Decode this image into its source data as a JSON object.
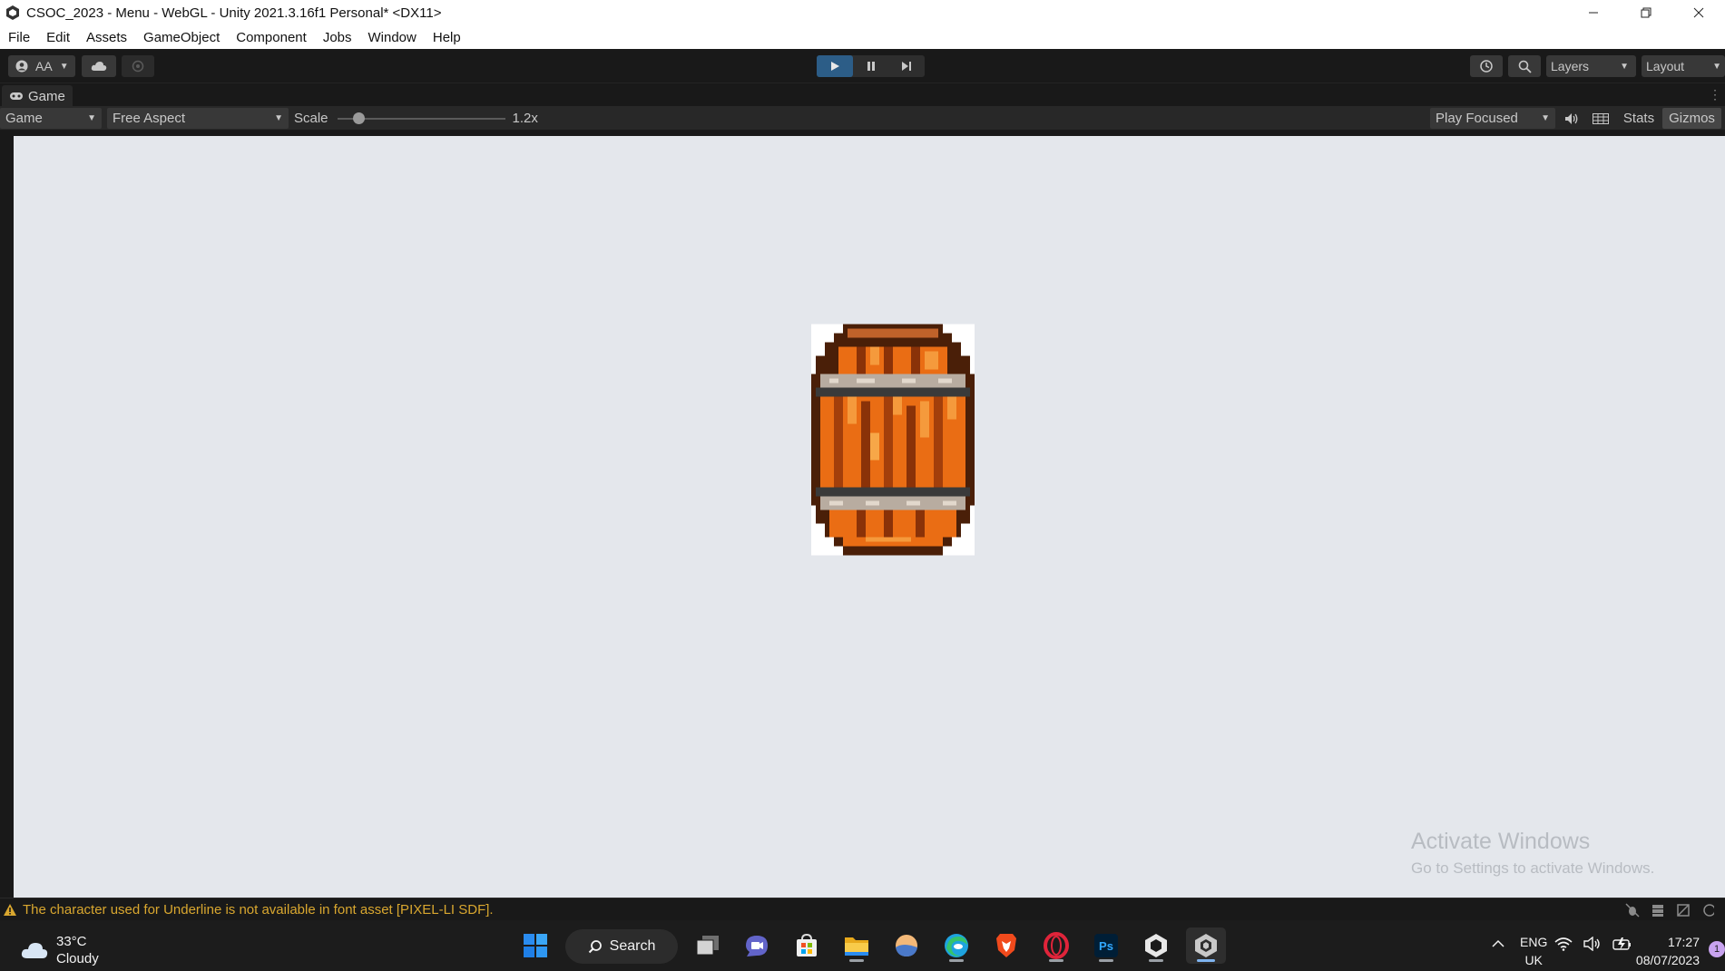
{
  "window": {
    "title": "CSOC_2023 - Menu - WebGL - Unity 2021.3.16f1 Personal* <DX11>",
    "minimize_icon": "minimize-icon",
    "restore_icon": "restore-icon",
    "close_icon": "close-icon"
  },
  "menu": {
    "items": [
      "File",
      "Edit",
      "Assets",
      "GameObject",
      "Component",
      "Jobs",
      "Window",
      "Help"
    ]
  },
  "toolbar": {
    "account_label": "AA",
    "layers_label": "Layers",
    "layout_label": "Layout",
    "play_active_color": "#2c5d87"
  },
  "game_tab": {
    "label": "Game"
  },
  "game_toolbar": {
    "display_label": "Game",
    "aspect_label": "Free Aspect",
    "scale_label": "Scale",
    "scale_value": "1.2x",
    "scale_slider_level": 0.1,
    "play_mode_label": "Play Focused",
    "stats_label": "Stats",
    "gizmos_label": "Gizmos"
  },
  "viewport": {
    "background_color": "#e4e7ec",
    "sprite": "wooden-barrel"
  },
  "watermark": {
    "title": "Activate Windows",
    "subtitle": "Go to Settings to activate Windows."
  },
  "status": {
    "message": "The character used for Underline is not available in font asset [PIXEL-LI SDF].",
    "warning_color": "#d9a72f"
  },
  "taskbar": {
    "weather_temp": "33°C",
    "weather_desc": "Cloudy",
    "search_label": "Search",
    "lang_line1": "ENG",
    "lang_line2": "UK",
    "time": "17:27",
    "date": "08/07/2023",
    "notification_count": "1"
  }
}
